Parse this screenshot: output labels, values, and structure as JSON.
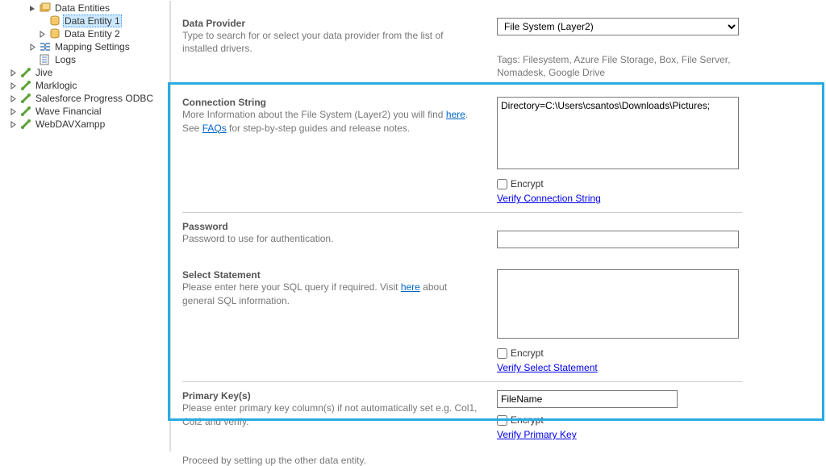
{
  "tree": {
    "dataEntities": "Data Entities",
    "dataEntity1": "Data Entity 1",
    "dataEntity2": "Data Entity 2",
    "mappingSettings": "Mapping Settings",
    "logs": "Logs",
    "jive": "Jive",
    "marklogic": "Marklogic",
    "salesforce": "Salesforce Progress ODBC",
    "waveFinancial": "Wave Financial",
    "webdav": "WebDAVXampp"
  },
  "dataProvider": {
    "title": "Data Provider",
    "desc": "Type to search for or select your data provider from the list of installed drivers.",
    "value": "File System (Layer2)",
    "tags": "Tags: Filesystem, Azure File Storage, Box, File Server, Nomadesk, Google Drive"
  },
  "connectionString": {
    "title": "Connection String",
    "desc_pre": "More Information about the File System (Layer2) you will find ",
    "desc_here": "here",
    "desc_mid": ". See ",
    "desc_faqs": "FAQs",
    "desc_post": " for step-by-step guides and release notes.",
    "value": "Directory=C:\\Users\\csantos\\Downloads\\Pictures;",
    "encrypt": "Encrypt",
    "verify": "Verify Connection String"
  },
  "password": {
    "title": "Password",
    "desc": "Password to use for authentication.",
    "value": ""
  },
  "selectStatement": {
    "title": "Select Statement",
    "desc_pre": "Please enter here your SQL query if required. Visit ",
    "desc_here": "here",
    "desc_post": " about general SQL information.",
    "value": "",
    "encrypt": "Encrypt",
    "verify": "Verify Select Statement"
  },
  "primaryKey": {
    "title": "Primary Key(s)",
    "desc": "Please enter primary key column(s) if not automatically set e.g. Col1, Col2 and verify.",
    "value": "FileName",
    "encrypt": "Encrypt",
    "verify": "Verify Primary Key"
  },
  "footer": "Proceed by setting up the other data entity."
}
